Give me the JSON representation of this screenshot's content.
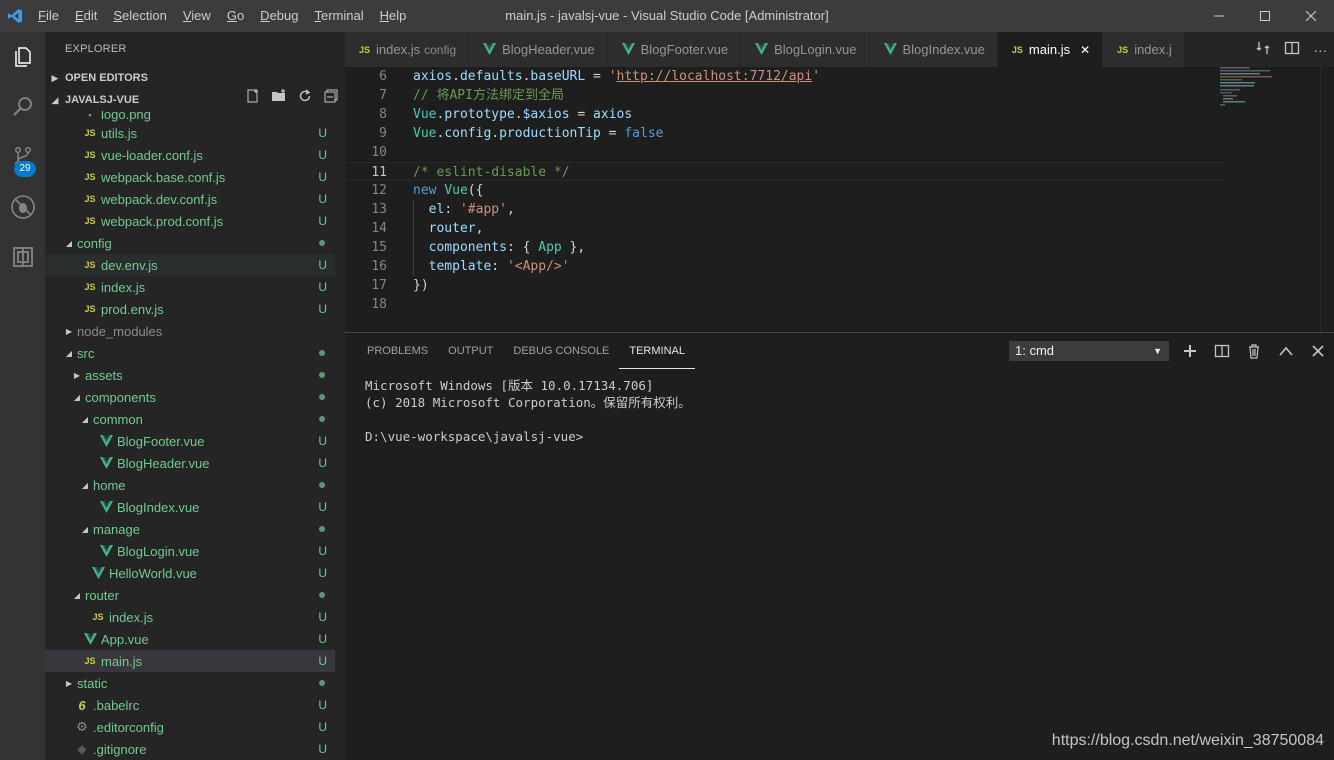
{
  "window": {
    "title": "main.js - javalsj-vue - Visual Studio Code [Administrator]",
    "menu": [
      "File",
      "Edit",
      "Selection",
      "View",
      "Go",
      "Debug",
      "Terminal",
      "Help"
    ]
  },
  "activity": {
    "scm_badge": "29"
  },
  "sidebar": {
    "title": "EXPLORER",
    "open_editors": "OPEN EDITORS",
    "project": "JAVALSJ-VUE",
    "tree": [
      {
        "label": "logo.png",
        "indent": 2,
        "icon": "img",
        "kind": "file",
        "status": "",
        "partial": true
      },
      {
        "label": "utils.js",
        "indent": 2,
        "icon": "js",
        "kind": "file",
        "status": "U"
      },
      {
        "label": "vue-loader.conf.js",
        "indent": 2,
        "icon": "js",
        "kind": "file",
        "status": "U"
      },
      {
        "label": "webpack.base.conf.js",
        "indent": 2,
        "icon": "js",
        "kind": "file",
        "status": "U"
      },
      {
        "label": "webpack.dev.conf.js",
        "indent": 2,
        "icon": "js",
        "kind": "file",
        "status": "U"
      },
      {
        "label": "webpack.prod.conf.js",
        "indent": 2,
        "icon": "js",
        "kind": "file",
        "status": "U"
      },
      {
        "label": "config",
        "indent": 1,
        "icon": "",
        "kind": "folder-open",
        "status": "dot"
      },
      {
        "label": "dev.env.js",
        "indent": 2,
        "icon": "js",
        "kind": "file",
        "status": "U",
        "hover": true
      },
      {
        "label": "index.js",
        "indent": 2,
        "icon": "js",
        "kind": "file",
        "status": "U"
      },
      {
        "label": "prod.env.js",
        "indent": 2,
        "icon": "js",
        "kind": "file",
        "status": "U"
      },
      {
        "label": "node_modules",
        "indent": 1,
        "icon": "",
        "kind": "folder-closed",
        "status": "",
        "dim": true
      },
      {
        "label": "src",
        "indent": 1,
        "icon": "",
        "kind": "folder-open",
        "status": "dot"
      },
      {
        "label": "assets",
        "indent": 2,
        "icon": "",
        "kind": "folder-closed",
        "status": "dot"
      },
      {
        "label": "components",
        "indent": 2,
        "icon": "",
        "kind": "folder-open",
        "status": "dot"
      },
      {
        "label": "common",
        "indent": 3,
        "icon": "",
        "kind": "folder-open",
        "status": "dot"
      },
      {
        "label": "BlogFooter.vue",
        "indent": 4,
        "icon": "vue",
        "kind": "file",
        "status": "U"
      },
      {
        "label": "BlogHeader.vue",
        "indent": 4,
        "icon": "vue",
        "kind": "file",
        "status": "U"
      },
      {
        "label": "home",
        "indent": 3,
        "icon": "",
        "kind": "folder-open",
        "status": "dot"
      },
      {
        "label": "BlogIndex.vue",
        "indent": 4,
        "icon": "vue",
        "kind": "file",
        "status": "U"
      },
      {
        "label": "manage",
        "indent": 3,
        "icon": "",
        "kind": "folder-open",
        "status": "dot"
      },
      {
        "label": "BlogLogin.vue",
        "indent": 4,
        "icon": "vue",
        "kind": "file",
        "status": "U"
      },
      {
        "label": "HelloWorld.vue",
        "indent": 3,
        "icon": "vue",
        "kind": "file",
        "status": "U"
      },
      {
        "label": "router",
        "indent": 2,
        "icon": "",
        "kind": "folder-open",
        "status": "dot"
      },
      {
        "label": "index.js",
        "indent": 3,
        "icon": "js",
        "kind": "file",
        "status": "U"
      },
      {
        "label": "App.vue",
        "indent": 2,
        "icon": "vue",
        "kind": "file",
        "status": "U"
      },
      {
        "label": "main.js",
        "indent": 2,
        "icon": "js",
        "kind": "file",
        "status": "U",
        "selected": true
      },
      {
        "label": "static",
        "indent": 1,
        "icon": "",
        "kind": "folder-closed",
        "status": "dot"
      },
      {
        "label": ".babelrc",
        "indent": 1,
        "icon": "babel",
        "kind": "file",
        "status": "U"
      },
      {
        "label": ".editorconfig",
        "indent": 1,
        "icon": "gear",
        "kind": "file",
        "status": "U"
      },
      {
        "label": ".gitignore",
        "indent": 1,
        "icon": "git",
        "kind": "file",
        "status": "U"
      }
    ]
  },
  "tabs": [
    {
      "label": "index.js",
      "desc": "config",
      "icon": "js",
      "active": false
    },
    {
      "label": "BlogHeader.vue",
      "desc": "",
      "icon": "vue",
      "active": false
    },
    {
      "label": "BlogFooter.vue",
      "desc": "",
      "icon": "vue",
      "active": false
    },
    {
      "label": "BlogLogin.vue",
      "desc": "",
      "icon": "vue",
      "active": false
    },
    {
      "label": "BlogIndex.vue",
      "desc": "",
      "icon": "vue",
      "active": false
    },
    {
      "label": "main.js",
      "desc": "",
      "icon": "js",
      "active": true
    },
    {
      "label": "index.j",
      "desc": "",
      "icon": "js",
      "active": false
    }
  ],
  "editor": {
    "current_line": 11,
    "lines": [
      {
        "n": "6",
        "tokens": [
          [
            "t-var",
            "axios"
          ],
          [
            "t-punc",
            "."
          ],
          [
            "t-var",
            "defaults"
          ],
          [
            "t-punc",
            "."
          ],
          [
            "t-var",
            "baseURL"
          ],
          [
            "t-punc",
            " = "
          ],
          [
            "t-str",
            "'"
          ],
          [
            "t-url",
            "http://localhost:7712/api"
          ],
          [
            "t-str",
            "'"
          ]
        ]
      },
      {
        "n": "7",
        "tokens": [
          [
            "t-cmt",
            "// 将API方法绑定到全局"
          ]
        ]
      },
      {
        "n": "8",
        "tokens": [
          [
            "t-cls",
            "Vue"
          ],
          [
            "t-punc",
            "."
          ],
          [
            "t-var",
            "prototype"
          ],
          [
            "t-punc",
            "."
          ],
          [
            "t-var",
            "$axios"
          ],
          [
            "t-punc",
            " = "
          ],
          [
            "t-var",
            "axios"
          ]
        ]
      },
      {
        "n": "9",
        "tokens": [
          [
            "t-cls",
            "Vue"
          ],
          [
            "t-punc",
            "."
          ],
          [
            "t-var",
            "config"
          ],
          [
            "t-punc",
            "."
          ],
          [
            "t-var",
            "productionTip"
          ],
          [
            "t-punc",
            " = "
          ],
          [
            "t-kw",
            "false"
          ]
        ]
      },
      {
        "n": "10",
        "tokens": []
      },
      {
        "n": "11",
        "tokens": [
          [
            "t-cmt",
            "/* eslint-disable */"
          ]
        ]
      },
      {
        "n": "12",
        "tokens": [
          [
            "t-kw",
            "new "
          ],
          [
            "t-cls",
            "Vue"
          ],
          [
            "t-punc",
            "({"
          ]
        ]
      },
      {
        "n": "13",
        "tokens": [
          [
            "t-punc",
            "  "
          ],
          [
            "t-var",
            "el"
          ],
          [
            "t-punc",
            ": "
          ],
          [
            "t-str",
            "'#app'"
          ],
          [
            "t-punc",
            ","
          ]
        ]
      },
      {
        "n": "14",
        "tokens": [
          [
            "t-punc",
            "  "
          ],
          [
            "t-var",
            "router"
          ],
          [
            "t-punc",
            ","
          ]
        ]
      },
      {
        "n": "15",
        "tokens": [
          [
            "t-punc",
            "  "
          ],
          [
            "t-var",
            "components"
          ],
          [
            "t-punc",
            ": { "
          ],
          [
            "t-cls",
            "App"
          ],
          [
            "t-punc",
            " },"
          ]
        ]
      },
      {
        "n": "16",
        "tokens": [
          [
            "t-punc",
            "  "
          ],
          [
            "t-var",
            "template"
          ],
          [
            "t-punc",
            ": "
          ],
          [
            "t-str",
            "'<App/>'"
          ]
        ]
      },
      {
        "n": "17",
        "tokens": [
          [
            "t-punc",
            "})"
          ]
        ]
      },
      {
        "n": "18",
        "tokens": []
      }
    ]
  },
  "panel": {
    "tabs": [
      "PROBLEMS",
      "OUTPUT",
      "DEBUG CONSOLE",
      "TERMINAL"
    ],
    "active_tab": "TERMINAL",
    "terminal_select": "1: cmd",
    "terminal_lines": [
      "Microsoft Windows [版本 10.0.17134.706]",
      "(c) 2018 Microsoft Corporation。保留所有权利。",
      "",
      "D:\\vue-workspace\\javalsj-vue>"
    ]
  },
  "watermark": "https://blog.csdn.net/weixin_38750084"
}
